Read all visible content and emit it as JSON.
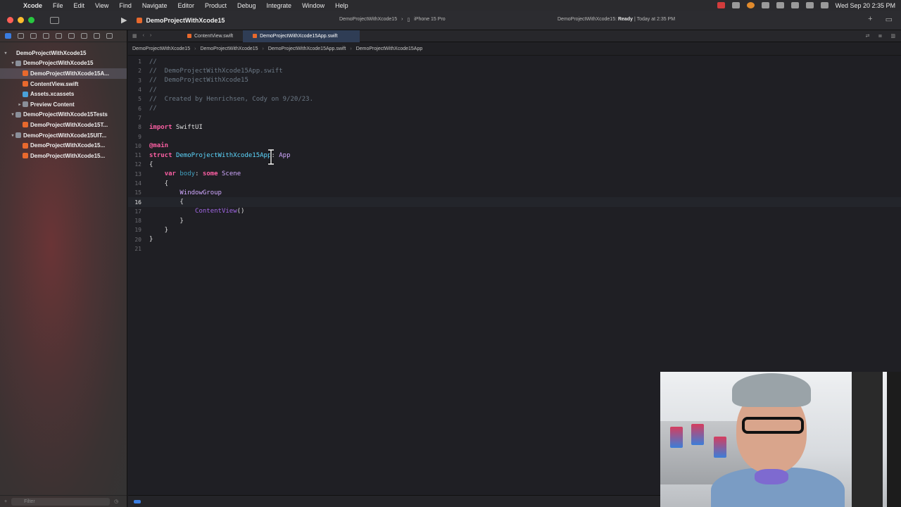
{
  "menubar": {
    "app": "Xcode",
    "items": [
      "File",
      "Edit",
      "View",
      "Find",
      "Navigate",
      "Editor",
      "Product",
      "Debug",
      "Integrate",
      "Window",
      "Help"
    ],
    "clock": "Wed Sep 20  2:35 PM"
  },
  "toolbar": {
    "project_title": "DemoProjectWithXcode15",
    "scheme": "DemoProjectWithXcode15",
    "device": "iPhone 15 Pro",
    "status_prefix": "DemoProjectWithXcode15: ",
    "status_state": "Ready",
    "status_time": " | Today at 2:35 PM"
  },
  "navigator": {
    "items": [
      {
        "label": "DemoProjectWithXcode15",
        "kind": "project",
        "indent": 0,
        "chevron": "▾"
      },
      {
        "label": "DemoProjectWithXcode15",
        "kind": "folder",
        "indent": 1,
        "chevron": "▾"
      },
      {
        "label": "DemoProjectWithXcode15A...",
        "kind": "swift",
        "indent": 2,
        "chevron": "",
        "selected": true
      },
      {
        "label": "ContentView.swift",
        "kind": "swift",
        "indent": 2,
        "chevron": ""
      },
      {
        "label": "Assets.xcassets",
        "kind": "assets",
        "indent": 2,
        "chevron": ""
      },
      {
        "label": "Preview Content",
        "kind": "folder",
        "indent": 2,
        "chevron": "▸"
      },
      {
        "label": "DemoProjectWithXcode15Tests",
        "kind": "folder",
        "indent": 1,
        "chevron": "▾"
      },
      {
        "label": "DemoProjectWithXcode15T...",
        "kind": "swift",
        "indent": 2,
        "chevron": ""
      },
      {
        "label": "DemoProjectWithXcode15UIT...",
        "kind": "folder",
        "indent": 1,
        "chevron": "▾"
      },
      {
        "label": "DemoProjectWithXcode15...",
        "kind": "swift",
        "indent": 2,
        "chevron": ""
      },
      {
        "label": "DemoProjectWithXcode15...",
        "kind": "swift",
        "indent": 2,
        "chevron": ""
      }
    ],
    "filter_placeholder": "Filter"
  },
  "tabs": [
    {
      "label": "ContentView.swift",
      "active": false
    },
    {
      "label": "DemoProjectWithXcode15App.swift",
      "active": true
    }
  ],
  "jumpbar": [
    "DemoProjectWithXcode15",
    "DemoProjectWithXcode15",
    "DemoProjectWithXcode15App.swift",
    "DemoProjectWithXcode15App"
  ],
  "code": {
    "current_line": 16,
    "lines": [
      {
        "n": "1",
        "parts": [
          [
            "c-com",
            "//"
          ]
        ]
      },
      {
        "n": "2",
        "parts": [
          [
            "c-com",
            "//  DemoProjectWithXcode15App.swift"
          ]
        ]
      },
      {
        "n": "3",
        "parts": [
          [
            "c-com",
            "//  DemoProjectWithXcode15"
          ]
        ]
      },
      {
        "n": "4",
        "parts": [
          [
            "c-com",
            "//"
          ]
        ]
      },
      {
        "n": "5",
        "parts": [
          [
            "c-com",
            "//  Created by Henrichsen, Cody on 9/20/23."
          ]
        ]
      },
      {
        "n": "6",
        "parts": [
          [
            "c-com",
            "//"
          ]
        ]
      },
      {
        "n": "7",
        "parts": []
      },
      {
        "n": "8",
        "parts": [
          [
            "c-kw",
            "import"
          ],
          [
            "c-plain",
            " SwiftUI"
          ]
        ]
      },
      {
        "n": "9",
        "parts": []
      },
      {
        "n": "10",
        "parts": [
          [
            "c-kw",
            "@main"
          ]
        ]
      },
      {
        "n": "11",
        "parts": [
          [
            "c-kw",
            "struct"
          ],
          [
            "c-plain",
            " "
          ],
          [
            "c-cls",
            "DemoProjectWithXcode15App"
          ],
          [
            "c-plain",
            ": "
          ],
          [
            "c-sys",
            "App"
          ]
        ]
      },
      {
        "n": "12",
        "parts": [
          [
            "c-plain",
            "{"
          ]
        ]
      },
      {
        "n": "13",
        "parts": [
          [
            "c-plain",
            "    "
          ],
          [
            "c-kw",
            "var"
          ],
          [
            "c-plain",
            " "
          ],
          [
            "c-var",
            "body"
          ],
          [
            "c-plain",
            ": "
          ],
          [
            "c-kw",
            "some"
          ],
          [
            "c-plain",
            " "
          ],
          [
            "c-sys",
            "Scene"
          ]
        ]
      },
      {
        "n": "14",
        "parts": [
          [
            "c-plain",
            "    {"
          ]
        ]
      },
      {
        "n": "15",
        "parts": [
          [
            "c-plain",
            "        "
          ],
          [
            "c-sys",
            "WindowGroup"
          ]
        ]
      },
      {
        "n": "16",
        "parts": [
          [
            "c-plain",
            "        {"
          ]
        ]
      },
      {
        "n": "17",
        "parts": [
          [
            "c-plain",
            "            "
          ],
          [
            "c-call",
            "ContentView"
          ],
          [
            "c-plain",
            "()"
          ]
        ]
      },
      {
        "n": "18",
        "parts": [
          [
            "c-plain",
            "        }"
          ]
        ]
      },
      {
        "n": "19",
        "parts": [
          [
            "c-plain",
            "    }"
          ]
        ]
      },
      {
        "n": "20",
        "parts": [
          [
            "c-plain",
            "}"
          ]
        ]
      },
      {
        "n": "21",
        "parts": []
      }
    ]
  }
}
